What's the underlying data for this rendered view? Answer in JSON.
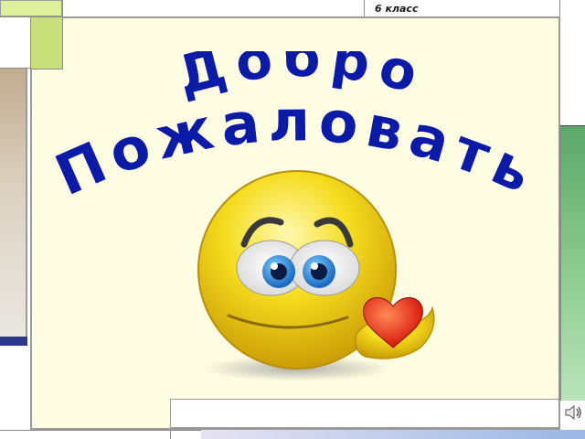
{
  "header": {
    "class_label": "6 класс"
  },
  "slide": {
    "welcome_word1": "Добро",
    "welcome_word2": "Пожаловать"
  },
  "icons": {
    "speaker": "speaker-icon",
    "smiley": "smiley-icon",
    "heart": "heart-icon"
  },
  "colors": {
    "slide_background": "#fffde1",
    "title_fill": "#0b1ba8",
    "accent_green": "#c8e07a",
    "accent_blue": "#2b3a8c",
    "smiley_yellow": "#f2d80f",
    "heart_red": "#e21a0d"
  }
}
